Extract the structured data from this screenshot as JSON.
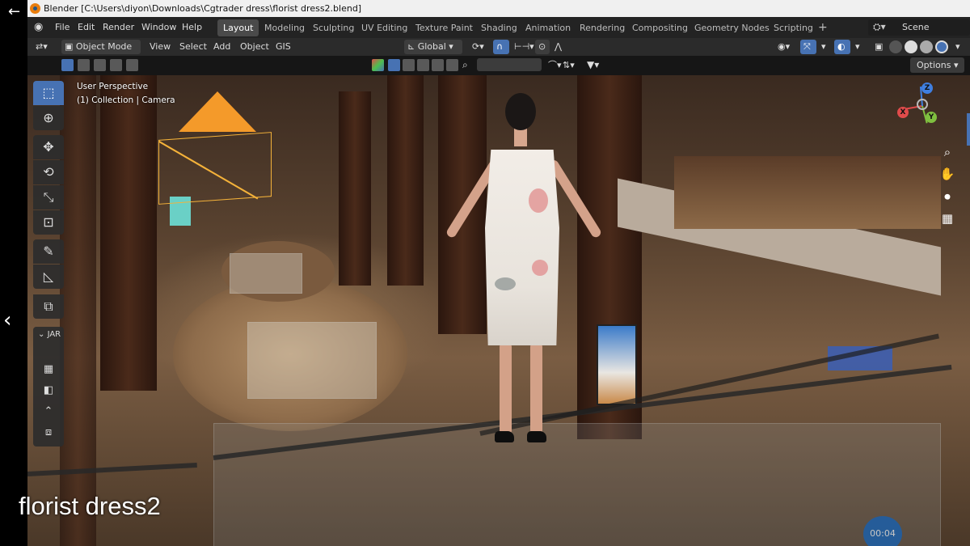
{
  "window": {
    "title": "Blender [C:\\Users\\diyon\\Downloads\\Cgtrader dress\\florist dress2.blend]"
  },
  "menubar": {
    "menus": [
      "File",
      "Edit",
      "Render",
      "Window",
      "Help"
    ],
    "workspaces": [
      "Layout",
      "Modeling",
      "Sculpting",
      "UV Editing",
      "Texture Paint",
      "Shading",
      "Animation",
      "Rendering",
      "Compositing",
      "Geometry Nodes",
      "Scripting"
    ],
    "active_workspace": "Layout",
    "add_symbol": "+",
    "scene": "Scene"
  },
  "viewport_header": {
    "mode": "Object Mode",
    "menus": [
      "View",
      "Select",
      "Add",
      "Object",
      "GIS"
    ],
    "transform_orientation": "Global",
    "options": "Options"
  },
  "viewport": {
    "perspective_label": "User Perspective",
    "collection_label": "(1) Collection | Camera"
  },
  "tool_panel": {
    "label": "JAR"
  },
  "gizmo": {
    "x": "X",
    "y": "Y",
    "z": "Z"
  },
  "overlay": {
    "caption": "florist dress2",
    "timer": "00:04"
  },
  "colors": {
    "accent": "#4772b3",
    "camera": "#f49a2a",
    "axis_x": "#e04b4b",
    "axis_y": "#7fbf3f",
    "axis_z": "#3f7fe0"
  }
}
